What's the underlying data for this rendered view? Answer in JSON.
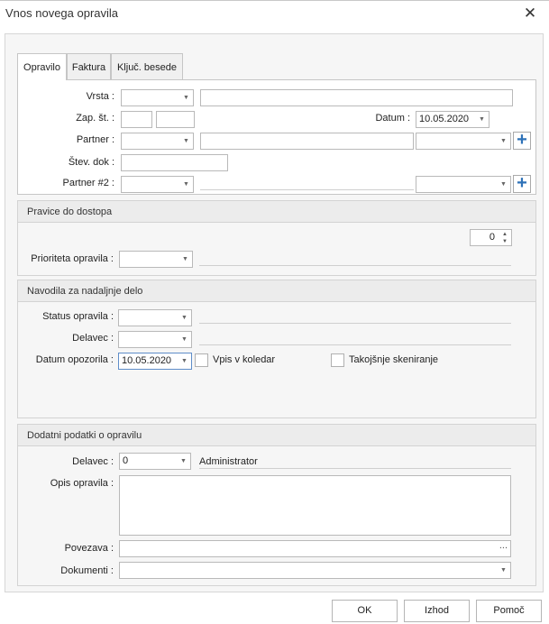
{
  "window": {
    "title": "Vnos novega opravila",
    "close_icon": "close-icon"
  },
  "tabs": [
    {
      "label": "Opravilo",
      "active": true
    },
    {
      "label": "Faktura",
      "active": false
    },
    {
      "label": "Ključ. besede",
      "active": false
    }
  ],
  "opravilo": {
    "vrsta_label": "Vrsta :",
    "zapst_label": "Zap. št. :",
    "datum_label": "Datum :",
    "datum_value": "10.05.2020",
    "partner_label": "Partner :",
    "stevdok_label": "Štev. dok :",
    "partner2_label": "Partner #2 :"
  },
  "pravice": {
    "header": "Pravice do dostopa",
    "spin_value": "0",
    "prioriteta_label": "Prioriteta opravila :"
  },
  "navodila": {
    "header": "Navodila za nadaljnje delo",
    "status_label": "Status opravila :",
    "delavec_label": "Delavec :",
    "datum_opozorila_label": "Datum opozorila :",
    "datum_opozorila_value": "10.05.2020",
    "vpis_koledar_label": "Vpis v koledar",
    "takojsnje_label": "Takojšnje skeniranje"
  },
  "dodatni": {
    "header": "Dodatni podatki o opravilu",
    "delavec_label": "Delavec :",
    "delavec_value": "0",
    "delavec_name": "Administrator",
    "opis_label": "Opis opravila :",
    "povezava_label": "Povezava :",
    "povezava_button": "...",
    "dokumenti_label": "Dokumenti :"
  },
  "buttons": {
    "ok": "OK",
    "izhod": "Izhod",
    "pomoc": "Pomoč"
  }
}
